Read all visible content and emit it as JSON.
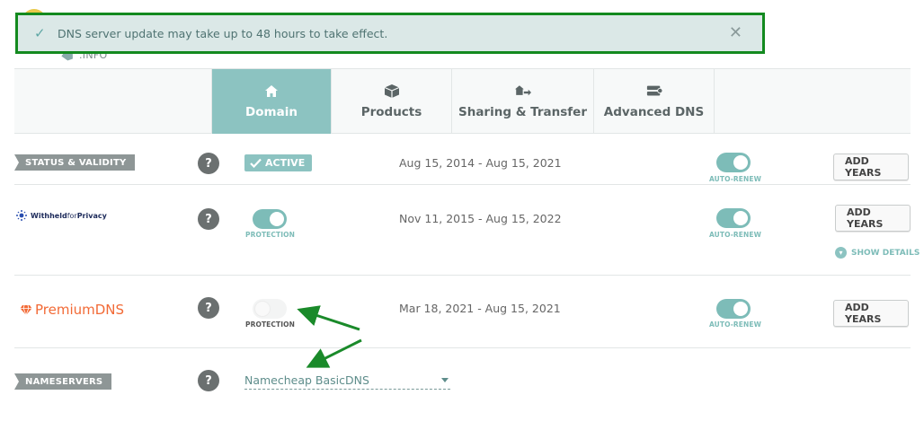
{
  "notice": {
    "message": "DNS server update may take up to 48 hours to take effect.",
    "close_glyph": "✕"
  },
  "domain_header": {
    "tld": ".INFO"
  },
  "tabs": [
    {
      "label": "Domain",
      "icon": "home-icon",
      "active": true
    },
    {
      "label": "Products",
      "icon": "box-icon",
      "active": false
    },
    {
      "label": "Sharing & Transfer",
      "icon": "share-transfer-icon",
      "active": false
    },
    {
      "label": "Advanced DNS",
      "icon": "server-icon",
      "active": false
    }
  ],
  "rows": {
    "status": {
      "label": "STATUS & VALIDITY",
      "help": "?",
      "status_badge": "ACTIVE",
      "dates": "Aug 15, 2014 - Aug 15, 2021",
      "auto_renew_label": "AUTO-RENEW",
      "auto_renew_on": true,
      "button": "ADD YEARS"
    },
    "privacy": {
      "logo_bold": "Withheld",
      "logo_light": "for",
      "logo_end": "Privacy",
      "help": "?",
      "protection_label": "PROTECTION",
      "protection_on": true,
      "dates": "Nov 11, 2015 - Aug 15, 2022",
      "auto_renew_label": "AUTO-RENEW",
      "auto_renew_on": true,
      "button": "ADD YEARS",
      "show_details": "SHOW DETAILS"
    },
    "premium_dns": {
      "logo": "PremiumDNS",
      "help": "?",
      "protection_label": "PROTECTION",
      "protection_on": false,
      "dates": "Mar 18, 2021 - Aug 15, 2021",
      "auto_renew_label": "AUTO-RENEW",
      "auto_renew_on": true,
      "button": "ADD YEARS"
    },
    "nameservers": {
      "label": "NAMESERVERS",
      "help": "?",
      "selected": "Namecheap BasicDNS"
    }
  },
  "colors": {
    "accent": "#8cc3c1",
    "highlight_border": "#138a1f",
    "annotation_arrow": "#1a8a2a",
    "premium_orange": "#f26a36"
  }
}
